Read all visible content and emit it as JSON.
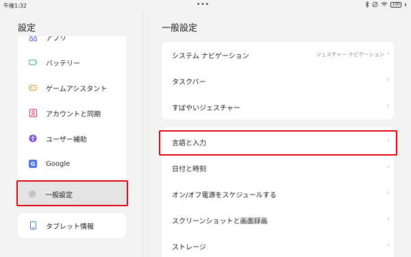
{
  "status_bar": {
    "time": "午後1:32",
    "center_dots": "•••",
    "battery": "100"
  },
  "left": {
    "title": "設定",
    "items": [
      {
        "label": "アプリ",
        "icon": "apps-grid-icon"
      },
      {
        "label": "バッテリー",
        "icon": "battery-icon"
      },
      {
        "label": "ゲームアシスタント",
        "icon": "gamepad-icon"
      },
      {
        "label": "アカウントと同期",
        "icon": "account-icon"
      },
      {
        "label": "ユーザー補助",
        "icon": "accessibility-icon"
      },
      {
        "label": "Google",
        "icon": "google-icon"
      },
      {
        "label": "一般設定",
        "icon": "gear-icon"
      }
    ],
    "tablet_info": {
      "label": "タブレット情報",
      "icon": "tablet-icon"
    }
  },
  "right": {
    "title": "一般設定",
    "group1": [
      {
        "label": "システム ナビゲーション",
        "value": "ジェスチャー ナビゲーション"
      },
      {
        "label": "タスクバー",
        "value": ""
      },
      {
        "label": "すばやいジェスチャー",
        "value": ""
      }
    ],
    "group2": [
      {
        "label": "言語と入力"
      },
      {
        "label": "日付と時刻"
      },
      {
        "label": "オン/オフ電源をスケジュールする"
      },
      {
        "label": "スクリーンショットと画面録画"
      },
      {
        "label": "ストレージ"
      }
    ],
    "chevron": "›"
  },
  "colors": {
    "accent_red": "#e0000f",
    "background": "#f3f3f3",
    "card": "#ffffff"
  }
}
